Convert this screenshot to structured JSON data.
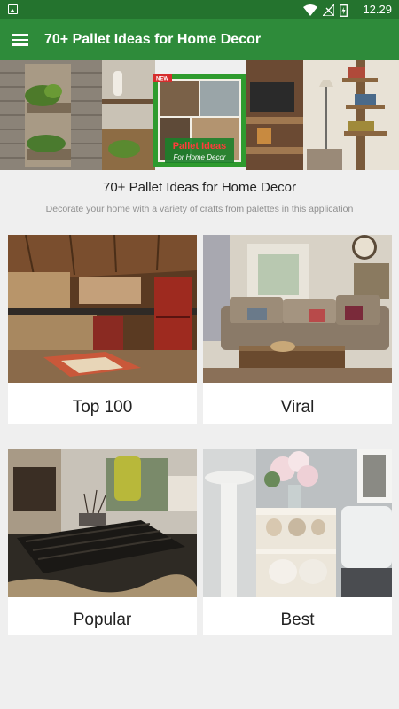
{
  "status_bar": {
    "time": "12.29",
    "icons": [
      "image-notification-icon",
      "wifi-icon",
      "no-signal-icon",
      "battery-charging-icon"
    ]
  },
  "app_bar": {
    "title": "70+ Pallet Ideas for Home Decor",
    "menu_icon": "hamburger-menu-icon"
  },
  "banner": {
    "badge": "NEW",
    "title_line1": "Pallet Ideas",
    "title_line2": "For Home Decor"
  },
  "header": {
    "title": "70+ Pallet Ideas for Home Decor",
    "subtitle": "Decorate your home with a variety of crafts from palettes in this application"
  },
  "categories": [
    {
      "label": "Top 100"
    },
    {
      "label": "Viral"
    },
    {
      "label": "Popular"
    },
    {
      "label": "Best"
    }
  ],
  "colors": {
    "status_bar": "#24732e",
    "app_bar": "#2e8b3a",
    "background": "#efefef"
  }
}
